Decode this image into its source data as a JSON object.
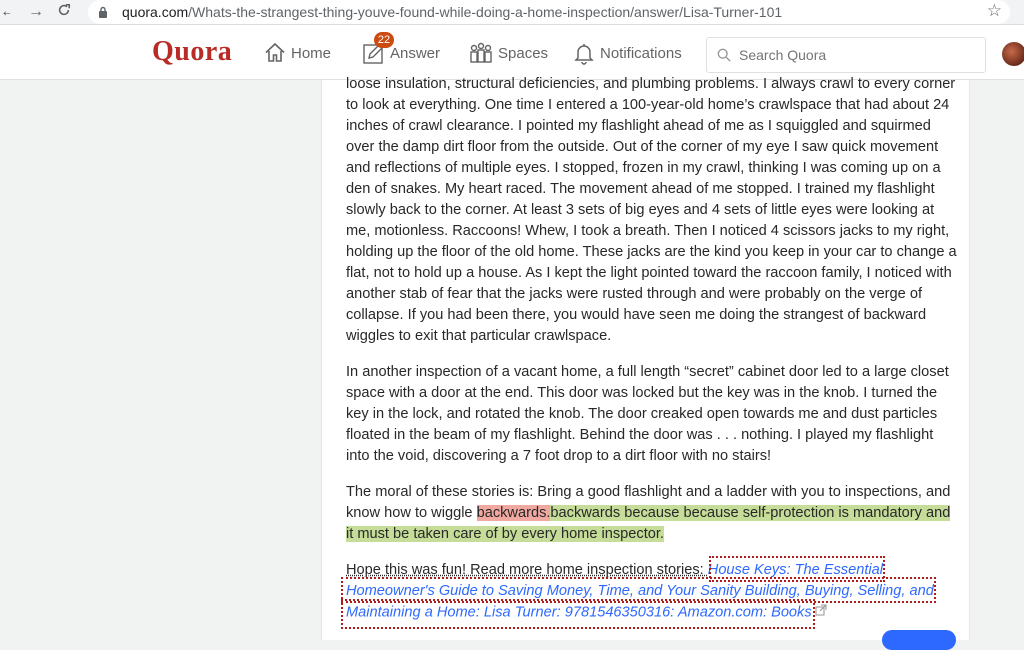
{
  "browser": {
    "url_host": "quora.com",
    "url_path": "/Whats-the-strangest-thing-youve-found-while-doing-a-home-inspection/answer/Lisa-Turner-101"
  },
  "header": {
    "logo": "Quora",
    "nav": {
      "home": "Home",
      "answer": "Answer",
      "answer_badge": "22",
      "spaces": "Spaces",
      "notifications": "Notifications"
    },
    "search_placeholder": "Search Quora"
  },
  "answer": {
    "p1": "loose insulation, structural deficiencies, and plumbing problems. I always crawl to every corner to look at everything. One time I entered a 100-year-old home’s crawlspace that had about 24 inches of crawl clearance. I pointed my flashlight ahead of me as I squiggled and squirmed over the damp dirt floor from the outside. Out of the corner of my eye I saw quick movement and reflections of multiple eyes. I stopped, frozen in my crawl, thinking I was coming up on a den of snakes. My heart raced. The movement ahead of me stopped. I trained my flashlight slowly back to the corner. At least 3 sets of big eyes and 4 sets of little eyes were looking at me, motionless. Raccoons! Whew, I took a breath. Then I noticed 4 scissors jacks to my right, holding up the floor of the old home. These jacks are the kind you keep in your car to change a flat, not to hold up a house. As I kept the light pointed toward the raccoon family, I noticed with another stab of fear that the jacks were rusted through and were probably on the verge of collapse. If you had been there, you would have seen me doing the strangest of backward wiggles to exit that particular crawlspace.",
    "p2": "In another inspection of a vacant home, a full length “secret” cabinet door led to a large closet space with a door at the end. This door was locked but the key was in the knob. I turned the key in the lock, and rotated the knob. The door creaked open towards me and dust particles floated in the beam of my flashlight. Behind the door was . . . nothing. I played my flashlight into the void, discovering a 7 foot drop to a dirt floor with no stairs!",
    "p3_prefix": "The moral of these stories is: Bring a good flashlight and a ladder with you to inspections, and know how to wiggle ",
    "p3_deleted": "backwards.",
    "p3_inserted": "backwards because because self-protection is mandatory and it must be taken care of by every home inspector.",
    "p4_prefix": "Hope this was fun! Read more home inspection stories: ",
    "p4_link": "House Keys: The Essential Homeowner's Guide to Saving Money, Time, and Your Sanity Building, Buying, Selling, and Maintaining a Home: Lisa Turner: 9781546350316: Amazon.com: Books"
  },
  "colors": {
    "quora_red": "#b92b27",
    "link_blue": "#2e69ff",
    "deleted_highlight": "#f0a8a0",
    "inserted_highlight": "#c5dd98",
    "annotation_box": "#b01c1c"
  },
  "icons": [
    "back-arrow-icon",
    "forward-arrow-icon",
    "reload-icon",
    "lock-icon",
    "star-icon",
    "home-icon",
    "answer-pencil-icon",
    "spaces-icon",
    "bell-icon",
    "search-icon",
    "external-link-icon"
  ]
}
